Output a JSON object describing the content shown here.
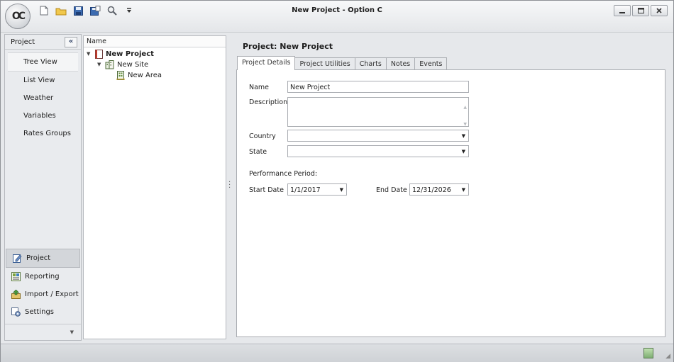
{
  "window": {
    "title": "New Project - Option C"
  },
  "app": {
    "logo_text": "OC"
  },
  "nav": {
    "header_label": "Project",
    "collapse_glyph": "«",
    "items": [
      {
        "label": "Tree View"
      },
      {
        "label": "List View"
      },
      {
        "label": "Weather"
      },
      {
        "label": "Variables"
      },
      {
        "label": "Rates Groups"
      }
    ],
    "groups": [
      {
        "label": "Project",
        "icon": "project-edit-icon"
      },
      {
        "label": "Reporting",
        "icon": "reporting-icon"
      },
      {
        "label": "Import / Export",
        "icon": "import-export-icon"
      },
      {
        "label": "Settings",
        "icon": "settings-icon"
      }
    ]
  },
  "tree": {
    "header": "Name",
    "nodes": [
      {
        "label": "New Project",
        "icon": "project-book-icon"
      },
      {
        "label": "New Site",
        "icon": "site-building-icon"
      },
      {
        "label": "New Area",
        "icon": "area-building-icon"
      }
    ]
  },
  "content": {
    "title": "Project: New Project",
    "tabs": [
      {
        "label": "Project Details",
        "active": true
      },
      {
        "label": "Project Utilities"
      },
      {
        "label": "Charts"
      },
      {
        "label": "Notes"
      },
      {
        "label": "Events"
      }
    ],
    "form": {
      "name_label": "Name",
      "name_value": "New Project",
      "description_label": "Description",
      "description_value": "",
      "country_label": "Country",
      "country_value": "",
      "state_label": "State",
      "state_value": "",
      "performance_label": "Performance Period:",
      "start_label": "Start Date",
      "start_value": "1/1/2017",
      "end_label": "End Date",
      "end_value": "12/31/2026"
    }
  },
  "colors": {
    "accent": "#2b3d62",
    "bg": "#e6e8eb"
  }
}
